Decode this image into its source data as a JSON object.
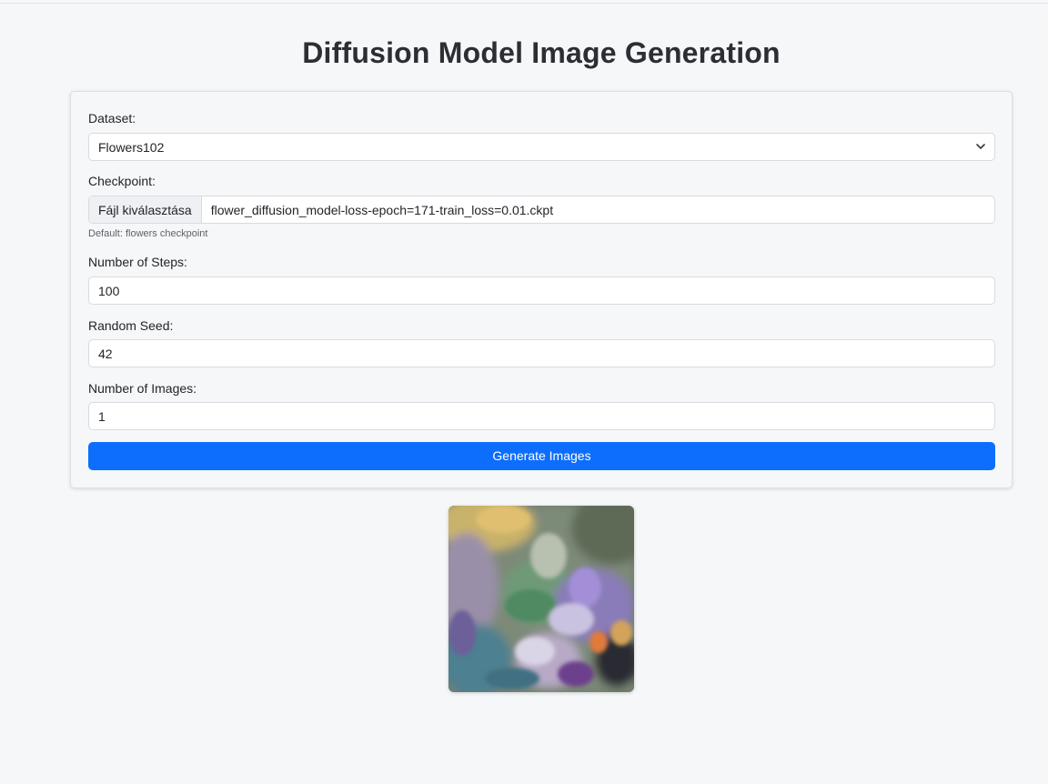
{
  "page": {
    "title": "Diffusion Model Image Generation"
  },
  "form": {
    "dataset": {
      "label": "Dataset:",
      "selected": "Flowers102"
    },
    "checkpoint": {
      "label": "Checkpoint:",
      "button_label": "Fájl kiválasztása",
      "file_name": "flower_diffusion_model-loss-epoch=171-train_loss=0.01.ckpt",
      "hint": "Default: flowers checkpoint"
    },
    "steps": {
      "label": "Number of Steps:",
      "value": "100"
    },
    "seed": {
      "label": "Random Seed:",
      "value": "42"
    },
    "num_images": {
      "label": "Number of Images:",
      "value": "1"
    },
    "generate_label": "Generate Images"
  },
  "colors": {
    "primary": "#0d6efd",
    "background": "#f6f7f9"
  }
}
